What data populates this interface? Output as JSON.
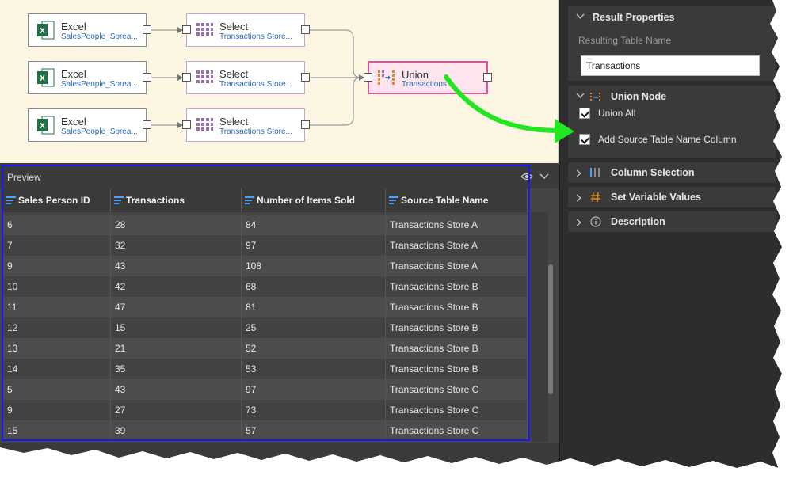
{
  "canvas": {
    "sources": [
      {
        "title": "Excel",
        "subtitle": "SalesPeople_Sprea..."
      },
      {
        "title": "Excel",
        "subtitle": "SalesPeople_Sprea..."
      },
      {
        "title": "Excel",
        "subtitle": "SalesPeople_Sprea..."
      }
    ],
    "selects": [
      {
        "title": "Select",
        "subtitle": "Transactions Store..."
      },
      {
        "title": "Select",
        "subtitle": "Transactions Store..."
      },
      {
        "title": "Select",
        "subtitle": "Transactions Store..."
      }
    ],
    "union": {
      "title": "Union",
      "subtitle": "Transactions"
    }
  },
  "preview": {
    "title": "Preview",
    "columns": [
      "Sales Person ID",
      "Transactions",
      "Number of Items Sold",
      "Source Table Name"
    ],
    "rows": [
      [
        "6",
        "28",
        "84",
        "Transactions Store A"
      ],
      [
        "7",
        "32",
        "97",
        "Transactions Store A"
      ],
      [
        "9",
        "43",
        "108",
        "Transactions Store A"
      ],
      [
        "10",
        "42",
        "68",
        "Transactions Store B"
      ],
      [
        "11",
        "47",
        "81",
        "Transactions Store B"
      ],
      [
        "12",
        "15",
        "25",
        "Transactions Store B"
      ],
      [
        "13",
        "21",
        "52",
        "Transactions Store B"
      ],
      [
        "14",
        "35",
        "53",
        "Transactions Store B"
      ],
      [
        "5",
        "43",
        "97",
        "Transactions Store C"
      ],
      [
        "9",
        "27",
        "73",
        "Transactions Store C"
      ],
      [
        "15",
        "39",
        "57",
        "Transactions Store C"
      ]
    ]
  },
  "panel": {
    "result_properties": {
      "label": "Result Properties",
      "field_label": "Resulting Table Name",
      "field_value": "Transactions"
    },
    "union_node": {
      "label": "Union Node",
      "union_all": "Union All",
      "add_source": "Add Source Table Name Column"
    },
    "column_selection": "Column Selection",
    "set_variable_values": "Set Variable Values",
    "description": "Description"
  },
  "colors": {
    "accent_blue": "#1818ff",
    "union_border": "#e0529a",
    "arrow_green": "#22e622",
    "canvas_bg": "#fdf6e3"
  }
}
